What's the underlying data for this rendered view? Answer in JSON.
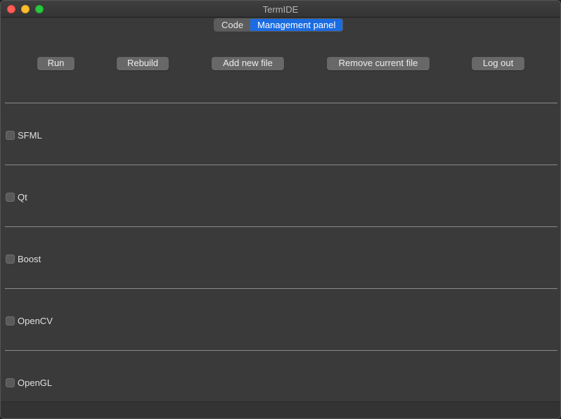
{
  "window": {
    "title": "TermIDE"
  },
  "tabs": [
    {
      "label": "Code",
      "active": false
    },
    {
      "label": "Management panel",
      "active": true
    }
  ],
  "toolbar": {
    "run": "Run",
    "rebuild": "Rebuild",
    "add_file": "Add new file",
    "remove_file": "Remove current file",
    "logout": "Log out"
  },
  "libraries": [
    {
      "label": "SFML",
      "checked": false
    },
    {
      "label": "Qt",
      "checked": false
    },
    {
      "label": "Boost",
      "checked": false
    },
    {
      "label": "OpenCV",
      "checked": false
    },
    {
      "label": "OpenGL",
      "checked": false
    }
  ],
  "colors": {
    "accent": "#1a6ce3",
    "background": "#3a3a3a",
    "button": "#686868"
  }
}
